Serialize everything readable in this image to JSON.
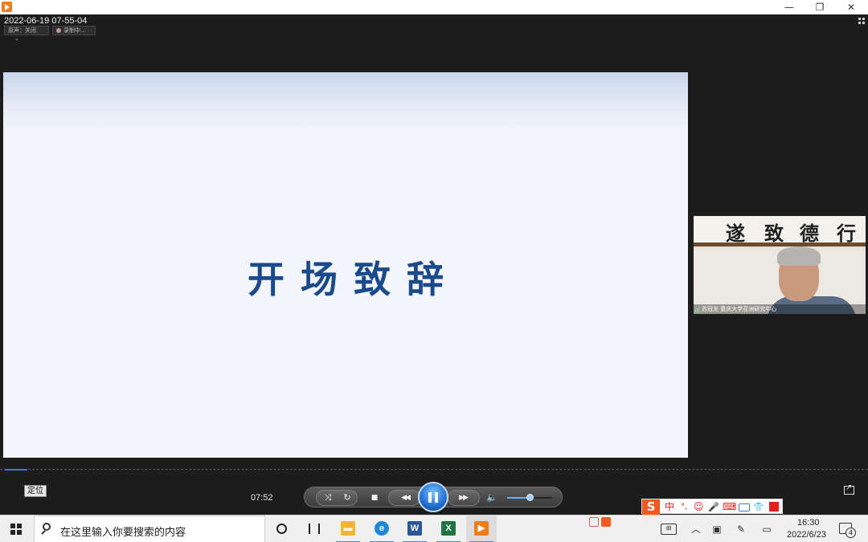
{
  "window": {
    "minimize_label": "—",
    "restore_label": "❐",
    "close_label": "✕"
  },
  "overlay": {
    "timestamp": "2022-06-19 07-55-04",
    "audio_pill": "原声：关闭",
    "audio_caret": "⌄",
    "recording_pill": "录制中..."
  },
  "slide": {
    "title": "开场致辞"
  },
  "participant": {
    "calligraphy_chars": [
      "遂",
      "致",
      "德",
      "行"
    ],
    "name_label": "苏冠龙 重庆大学亚洲研究中心"
  },
  "player": {
    "locate_label": "定位",
    "elapsed_time": "07:52",
    "progress_fraction": 0.026,
    "volume_fraction": 0.5,
    "controls": {
      "repeat": "↻",
      "stop": "■",
      "rewind": "◀◀",
      "forward": "▶▶",
      "volume": "🔈"
    }
  },
  "ime": {
    "logo": "S",
    "mode": "中",
    "punct": "°,",
    "emoji": "☺",
    "mic": "🎤",
    "keyboard": "⌨",
    "shirt": "👕"
  },
  "taskbar": {
    "search_placeholder": "在这里输入你要搜索的内容",
    "clock_time": "16:30",
    "clock_date": "2022/6/23",
    "notification_count": "4",
    "apps": [
      {
        "name": "file-explorer",
        "glyph": "▬",
        "color": "#f2b632"
      },
      {
        "name": "edge",
        "glyph": "e",
        "color": "#1e88d4"
      },
      {
        "name": "word",
        "glyph": "W",
        "color": "#2b5797"
      },
      {
        "name": "excel",
        "glyph": "X",
        "color": "#1f7244"
      },
      {
        "name": "video-player",
        "glyph": "▶",
        "color": "#f07d1b"
      }
    ]
  },
  "colors": {
    "slide_title": "#1a4a8a",
    "accent_blue": "#1f6fd1",
    "ime_red": "#f05a22"
  }
}
